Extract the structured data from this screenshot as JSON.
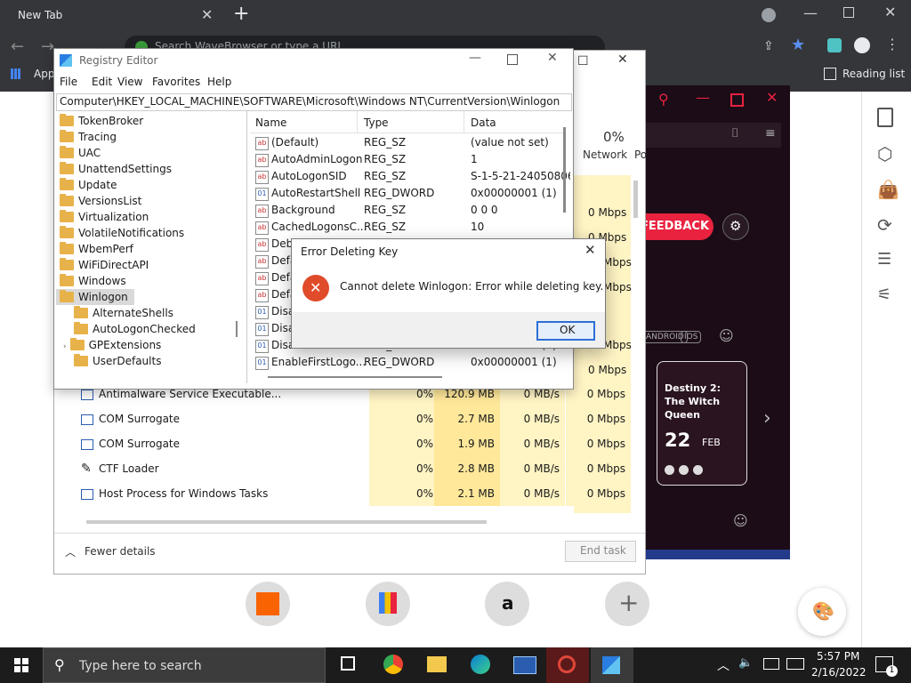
{
  "browser": {
    "tab_title": "New Tab",
    "address_placeholder": "Search WaveBrowser or type a URL",
    "bookmarks_label": "Apps",
    "reading_list": "Reading list",
    "shortcuts": [
      "home-depot",
      "shopping-bag",
      "amazon",
      "add"
    ]
  },
  "game": {
    "feedback": "FEEDBACK",
    "tags": [
      "ANDROID",
      "IOS"
    ],
    "title": "Destiny 2: The Witch Queen",
    "day": "22",
    "month": "FEB"
  },
  "taskmgr": {
    "network_pct": "0%",
    "network_label": "Network",
    "col_p": "Po",
    "rows": [
      {
        "name": "Antimalware Service Executable...",
        "cpu": "0%",
        "mem": "120.9 MB",
        "disk": "0 MB/s",
        "net": "0 Mbps"
      },
      {
        "name": "COM Surrogate",
        "cpu": "0%",
        "mem": "2.7 MB",
        "disk": "0 MB/s",
        "net": "0 Mbps"
      },
      {
        "name": "COM Surrogate",
        "cpu": "0%",
        "mem": "1.9 MB",
        "disk": "0 MB/s",
        "net": "0 Mbps"
      },
      {
        "name": "CTF Loader",
        "cpu": "0%",
        "mem": "2.8 MB",
        "disk": "0 MB/s",
        "net": "0 Mbps"
      },
      {
        "name": "Host Process for Windows Tasks",
        "cpu": "0%",
        "mem": "2.1 MB",
        "disk": "0 MB/s",
        "net": "0 Mbps"
      }
    ],
    "upper_net": [
      "0 Mbps",
      "0 Mbps",
      "Mbps",
      "Mbps",
      "Mbps",
      "0 Mbps"
    ],
    "fewer_details": "Fewer details",
    "end_task": "End task"
  },
  "regedit": {
    "title": "Registry Editor",
    "menu": [
      "File",
      "Edit",
      "View",
      "Favorites",
      "Help"
    ],
    "path": "Computer\\HKEY_LOCAL_MACHINE\\SOFTWARE\\Microsoft\\Windows NT\\CurrentVersion\\Winlogon",
    "tree": [
      "TokenBroker",
      "Tracing",
      "UAC",
      "UnattendSettings",
      "Update",
      "VersionsList",
      "Virtualization",
      "VolatileNotifications",
      "WbemPerf",
      "WiFiDirectAPI",
      "Windows",
      "Winlogon"
    ],
    "subtree": [
      "AlternateShells",
      "AutoLogonChecked",
      "GPExtensions",
      "UserDefaults"
    ],
    "columns": {
      "name": "Name",
      "type": "Type",
      "data": "Data"
    },
    "values": [
      {
        "name": "(Default)",
        "type": "REG_SZ",
        "data": "(value not set)",
        "kind": "ab"
      },
      {
        "name": "AutoAdminLogon",
        "type": "REG_SZ",
        "data": "1",
        "kind": "ab"
      },
      {
        "name": "AutoLogonSID",
        "type": "REG_SZ",
        "data": "S-1-5-21-24050806",
        "kind": "ab"
      },
      {
        "name": "AutoRestartShell",
        "type": "REG_DWORD",
        "data": "0x00000001 (1)",
        "kind": "bin"
      },
      {
        "name": "Background",
        "type": "REG_SZ",
        "data": "0 0 0",
        "kind": "ab"
      },
      {
        "name": "CachedLogonsC...",
        "type": "REG_SZ",
        "data": "10",
        "kind": "ab"
      },
      {
        "name": "Debu",
        "type": "",
        "data": "",
        "kind": "ab"
      },
      {
        "name": "Defa",
        "type": "",
        "data": "",
        "kind": "ab"
      },
      {
        "name": "Defa",
        "type": "",
        "data": "",
        "kind": "ab"
      },
      {
        "name": "Defa",
        "type": "",
        "data": "",
        "kind": "ab"
      },
      {
        "name": "Disa",
        "type": "",
        "data": "",
        "kind": "bin"
      },
      {
        "name": "Disa",
        "type": "",
        "data": "",
        "kind": "bin"
      },
      {
        "name": "DisableLockWor...",
        "type": "REG_DWORD",
        "data": "0x00000000 (0)",
        "kind": "bin"
      },
      {
        "name": "EnableFirstLogo...",
        "type": "REG_DWORD",
        "data": "0x00000001 (1)",
        "kind": "bin"
      }
    ]
  },
  "dialog": {
    "title": "Error Deleting Key",
    "message": "Cannot delete Winlogon:  Error while deleting key.",
    "ok": "OK"
  },
  "taskbar": {
    "search_placeholder": "Type here to search",
    "time": "5:57 PM",
    "date": "2/16/2022",
    "notif_count": "1"
  },
  "colors": {
    "accent_blue": "#2b6fd6",
    "error_red": "#e04b2a",
    "taskmgr_yellow": "#fff4c4",
    "feedback_red": "#e8223f"
  }
}
